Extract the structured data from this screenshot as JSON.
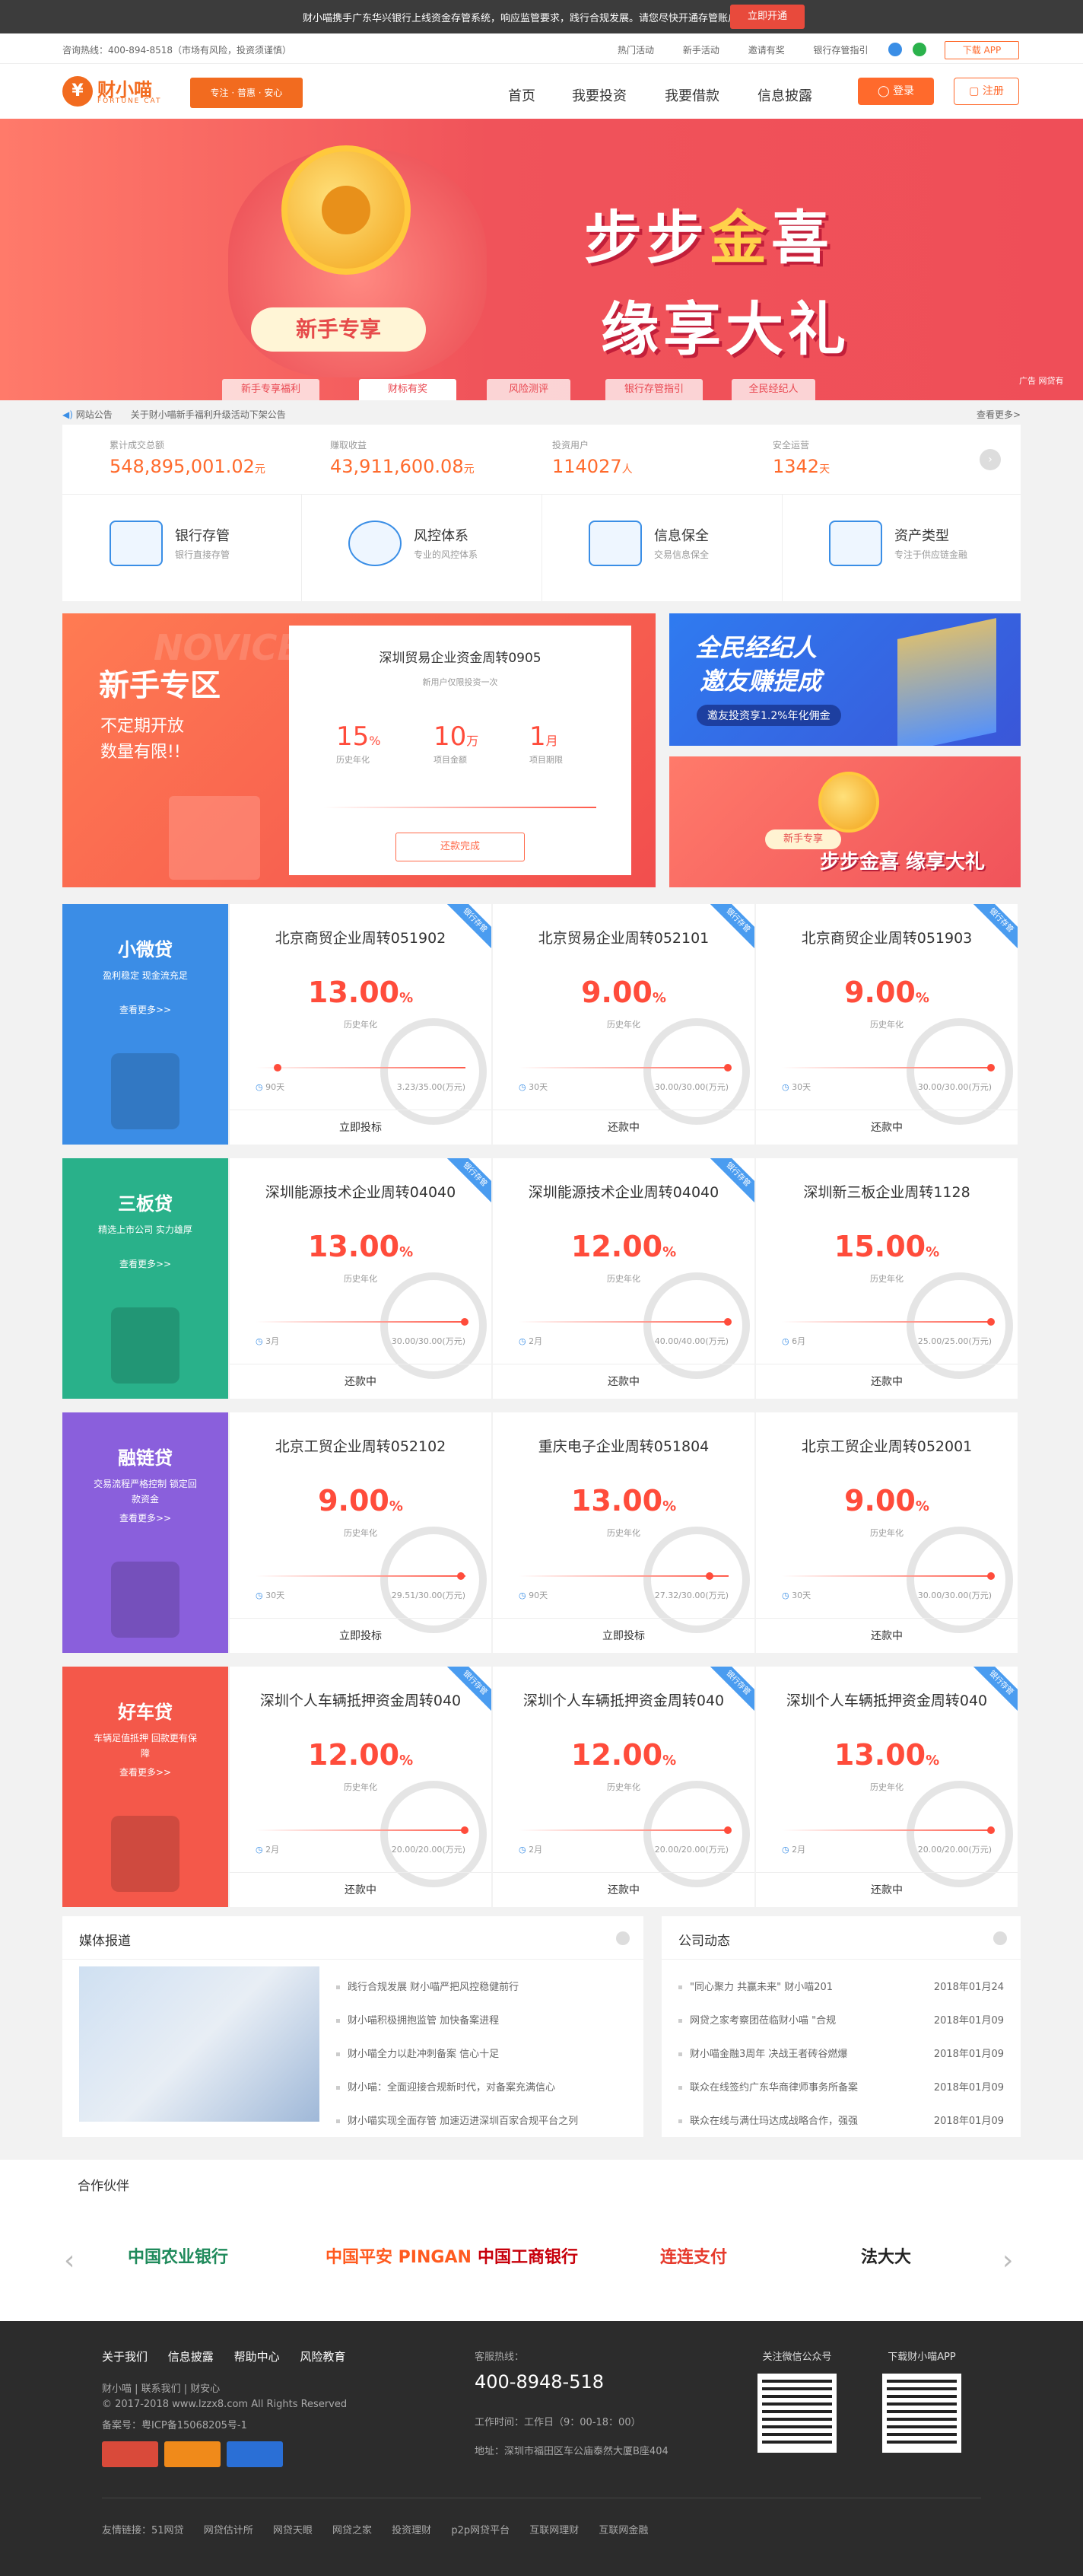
{
  "notice": {
    "text": "财小喵携手广东华兴银行上线资金存管系统，响应监管要求，践行合规发展。请您尽快开通存管账户！",
    "button": "立即开通"
  },
  "utility": {
    "hotline": "咨询热线：400-894-8518（市场有风险，投资须谨慎）",
    "links": [
      "热门活动",
      "新手活动",
      "邀请有奖",
      "银行存管指引"
    ],
    "app": "下载 APP"
  },
  "header": {
    "logo_cn": "财小喵",
    "logo_en": "FORTUNE CAT",
    "tagline": "专注 · 普惠 · 安心",
    "nav": [
      "首页",
      "我要投资",
      "我要借款",
      "信息披露"
    ],
    "login": "登录",
    "register": "注册"
  },
  "banner": {
    "pill": "新手专享",
    "slogan_a": "步步",
    "slogan_gold": "金",
    "slogan_b": "喜",
    "slogan2": "缘享大礼",
    "tabs": [
      "新手专享福利",
      "财标有奖",
      "风险测评",
      "银行存管指引",
      "全民经纪人"
    ],
    "ad": "广告 网贷有"
  },
  "announcement": {
    "label": "网站公告",
    "text": "关于财小喵新手福利升级活动下架公告",
    "more": "查看更多>"
  },
  "stats": [
    {
      "label": "累计成交总额",
      "value": "548,895,001.02",
      "unit": "元"
    },
    {
      "label": "赚取收益",
      "value": "43,911,600.08",
      "unit": "元"
    },
    {
      "label": "投资用户",
      "value": "114027",
      "unit": "人"
    },
    {
      "label": "安全运营",
      "value": "1342",
      "unit": "天"
    }
  ],
  "features": [
    {
      "title": "银行存管",
      "desc": "银行直接存管",
      "icon": "safe-icon"
    },
    {
      "title": "风控体系",
      "desc": "专业的风控体系",
      "icon": "gauge-icon"
    },
    {
      "title": "信息保全",
      "desc": "交易信息保全",
      "icon": "document-icon"
    },
    {
      "title": "资产类型",
      "desc": "专注于供应链金融",
      "icon": "card-icon"
    }
  ],
  "novice": {
    "heading": "新手专区",
    "watermark": "NOVICE",
    "line1": "不定期开放",
    "line2": "数量有限!!",
    "card": {
      "title": "深圳贸易企业资金周转0905",
      "sub": "新用户仅限投资一次",
      "rate": "15",
      "rate_unit": "%",
      "rate_label": "历史年化",
      "amount": "10",
      "amount_unit": "万",
      "amount_label": "项目金额",
      "term": "1",
      "term_unit": "月",
      "term_label": "项目期限",
      "button": "还款完成"
    }
  },
  "promo1": {
    "line1": "全民经纪人",
    "line2": "邀友赚提成",
    "line3": "邀友投资享1.2%年化佣金"
  },
  "promo2": {
    "pill": "新手专享",
    "text": "步步金喜 缘享大礼"
  },
  "categories": [
    {
      "name": "小微贷",
      "desc": "盈利稳定 现金流充足",
      "more": "查看更多>>",
      "color": "#3b8de6",
      "products": [
        {
          "title": "北京商贸企业周转051902",
          "rate": "13.00",
          "rate_label": "历史年化",
          "term": "90天",
          "amount": "3.23/35.00(万元)",
          "action": "立即投标",
          "ribbon": "银行存管",
          "progress": 0.09
        },
        {
          "title": "北京贸易企业周转052101",
          "rate": "9.00",
          "rate_label": "历史年化",
          "term": "30天",
          "amount": "30.00/30.00(万元)",
          "action": "还款中",
          "ribbon": "银行存管",
          "progress": 1.0
        },
        {
          "title": "北京商贸企业周转051903",
          "rate": "9.00",
          "rate_label": "历史年化",
          "term": "30天",
          "amount": "30.00/30.00(万元)",
          "action": "还款中",
          "ribbon": "银行存管",
          "progress": 1.0
        }
      ]
    },
    {
      "name": "三板贷",
      "desc": "精选上市公司 实力雄厚",
      "more": "查看更多>>",
      "color": "#29b18a",
      "products": [
        {
          "title": "深圳能源技术企业周转04040",
          "rate": "13.00",
          "rate_label": "历史年化",
          "term": "3月",
          "amount": "30.00/30.00(万元)",
          "action": "还款中",
          "ribbon": "银行存管",
          "progress": 1.0
        },
        {
          "title": "深圳能源技术企业周转04040",
          "rate": "12.00",
          "rate_label": "历史年化",
          "term": "2月",
          "amount": "40.00/40.00(万元)",
          "action": "还款中",
          "ribbon": "银行存管",
          "progress": 1.0
        },
        {
          "title": "深圳新三板企业周转1128",
          "rate": "15.00",
          "rate_label": "历史年化",
          "term": "6月",
          "amount": "25.00/25.00(万元)",
          "action": "还款中",
          "ribbon": "",
          "progress": 1.0
        }
      ]
    },
    {
      "name": "融链贷",
      "desc": "交易流程严格控制 锁定回款资金",
      "more": "查看更多>>",
      "color": "#8a5fdc",
      "products": [
        {
          "title": "北京工贸企业周转052102",
          "rate": "9.00",
          "rate_label": "历史年化",
          "term": "30天",
          "amount": "29.51/30.00(万元)",
          "action": "立即投标",
          "ribbon": "",
          "progress": 0.98
        },
        {
          "title": "重庆电子企业周转051804",
          "rate": "13.00",
          "rate_label": "历史年化",
          "term": "90天",
          "amount": "27.32/30.00(万元)",
          "action": "立即投标",
          "ribbon": "",
          "progress": 0.91
        },
        {
          "title": "北京工贸企业周转052001",
          "rate": "9.00",
          "rate_label": "历史年化",
          "term": "30天",
          "amount": "30.00/30.00(万元)",
          "action": "还款中",
          "ribbon": "",
          "progress": 1.0
        }
      ]
    },
    {
      "name": "好车贷",
      "desc": "车辆足值抵押 回款更有保障",
      "more": "查看更多>>",
      "color": "#f4584a",
      "products": [
        {
          "title": "深圳个人车辆抵押资金周转040",
          "rate": "12.00",
          "rate_label": "历史年化",
          "term": "2月",
          "amount": "20.00/20.00(万元)",
          "action": "还款中",
          "ribbon": "银行存管",
          "progress": 1.0
        },
        {
          "title": "深圳个人车辆抵押资金周转040",
          "rate": "12.00",
          "rate_label": "历史年化",
          "term": "2月",
          "amount": "20.00/20.00(万元)",
          "action": "还款中",
          "ribbon": "银行存管",
          "progress": 1.0
        },
        {
          "title": "深圳个人车辆抵押资金周转040",
          "rate": "13.00",
          "rate_label": "历史年化",
          "term": "2月",
          "amount": "20.00/20.00(万元)",
          "action": "还款中",
          "ribbon": "银行存管",
          "progress": 1.0
        }
      ]
    }
  ],
  "media": {
    "title": "媒体报道",
    "items": [
      "践行合规发展 财小喵严把风控稳健前行",
      "财小喵积极拥抱监管 加快备案进程",
      "财小喵全力以赴冲刺备案 信心十足",
      "财小喵：全面迎接合规新时代，对备案充满信心",
      "财小喵实现全面存管 加速迈进深圳百家合规平台之列"
    ]
  },
  "company": {
    "title": "公司动态",
    "items": [
      {
        "text": "\"同心聚力 共赢未来\" 财小喵201",
        "date": "2018年01月24"
      },
      {
        "text": "网贷之家考察团莅临财小喵 \"合规",
        "date": "2018年01月09"
      },
      {
        "text": "财小喵金融3周年 决战王者砖谷燃爆",
        "date": "2018年01月09"
      },
      {
        "text": "联众在线签约广东华商律师事务所备案",
        "date": "2018年01月09"
      },
      {
        "text": "联众在线与满仕玛达成战略合作，强强",
        "date": "2018年01月09"
      }
    ]
  },
  "partners": {
    "title": "合作伙伴",
    "logos": [
      {
        "name": "中国农业银行",
        "color": "#1f8a5b"
      },
      {
        "name": "中国平安 PINGAN",
        "color": "#ff5a1f"
      },
      {
        "name": "中国工商银行",
        "color": "#c7000b"
      },
      {
        "name": "连连支付",
        "color": "#e63a2c"
      },
      {
        "name": "法大大",
        "color": "#222222"
      }
    ]
  },
  "footer": {
    "links": [
      "关于我们",
      "信息披露",
      "帮助中心",
      "风险教育"
    ],
    "sub": "财小喵 | 联系我们 | 财安心",
    "copyright": "© 2017-2018 www.lzzx8.com All Rights Reserved",
    "icp": "备案号：粤ICP备15068205号-1",
    "service_label": "客服热线：",
    "phone": "400-8948-518",
    "hours": "工作时间：工作日（9：00-18：00）",
    "address": "地址：深圳市福田区车公庙泰然大厦B座404",
    "wechat": "关注微信公众号",
    "app": "下载财小喵APP",
    "friend_links": [
      "友情链接：51网贷",
      "网贷估计所",
      "网贷天眼",
      "网贷之家",
      "投资理财",
      "p2p网贷平台",
      "互联网理财",
      "互联网金融"
    ]
  },
  "colors": {
    "primary": "#ff6a2c",
    "rate": "#ff4c3b",
    "banner": "#ef4e58"
  }
}
